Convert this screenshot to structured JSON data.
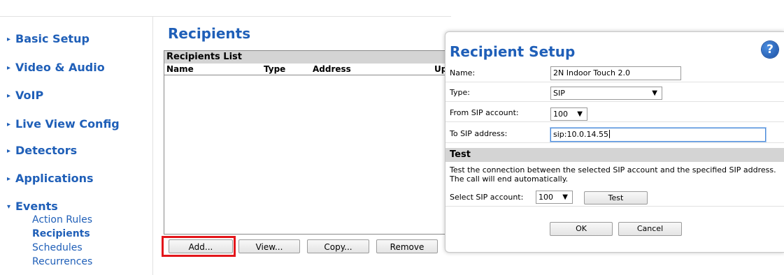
{
  "sidebar": {
    "items": [
      {
        "label": "Basic Setup"
      },
      {
        "label": "Video & Audio"
      },
      {
        "label": "VoIP"
      },
      {
        "label": "Live View Config"
      },
      {
        "label": "Detectors"
      },
      {
        "label": "Applications"
      },
      {
        "label": "Events"
      }
    ],
    "collapsed_arrow": "▸",
    "expanded_arrow": "▾",
    "events_subitems": [
      "Action Rules",
      "Recipients",
      "Schedules",
      "Recurrences"
    ]
  },
  "main": {
    "title": "Recipients",
    "list_header": "Recipients List",
    "columns": [
      "Name",
      "Type",
      "Address",
      "Uplo"
    ],
    "buttons": {
      "add": "Add...",
      "view": "View...",
      "copy": "Copy...",
      "remove": "Remove"
    }
  },
  "dialog": {
    "title": "Recipient Setup",
    "help_glyph": "?",
    "fields": {
      "name_label": "Name:",
      "name_value": "2N Indoor Touch 2.0",
      "type_label": "Type:",
      "type_value": "SIP",
      "from_label": "From SIP account:",
      "from_value": "100",
      "to_label": "To SIP address:",
      "to_value": "sip:10.0.14.55"
    },
    "test": {
      "header": "Test",
      "description": "Test the connection between the selected SIP account and the specified SIP address. The call will end automatically.",
      "select_label": "Select SIP account:",
      "select_value": "100",
      "test_button": "Test"
    },
    "ok_button": "OK",
    "cancel_button": "Cancel",
    "caret": "▼"
  },
  "colors": {
    "accent": "#1f5fb8",
    "highlight": "#e3161b",
    "bar": "#d4d4d4"
  }
}
